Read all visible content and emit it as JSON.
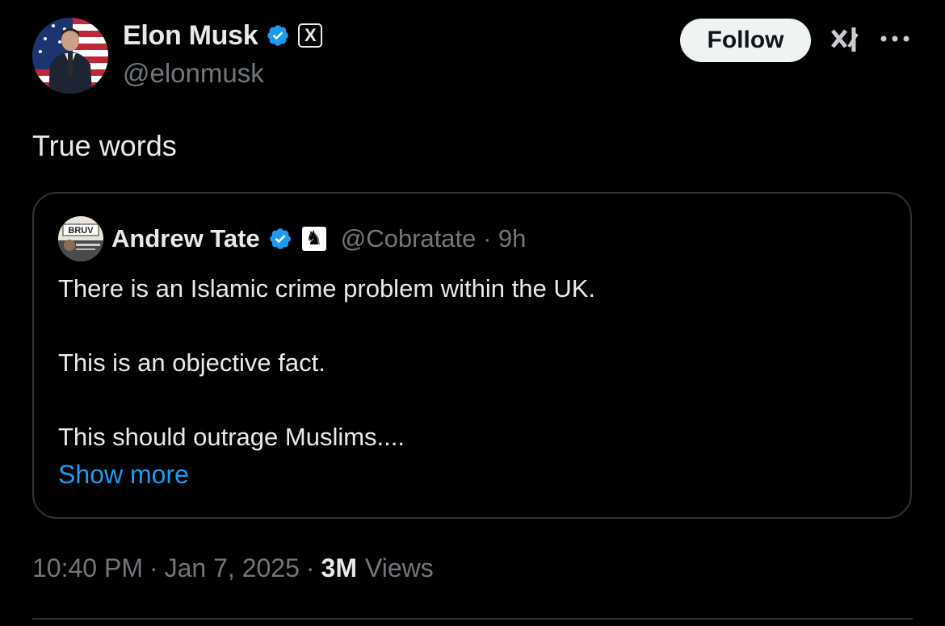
{
  "author": {
    "display_name": "Elon Musk",
    "handle": "@elonmusk",
    "verified_badge_color": "#1d9bf0",
    "affiliation_badge_glyph": "X"
  },
  "actions": {
    "follow_label": "Follow",
    "grok_icon": "grok-icon",
    "more_icon": "more-icon"
  },
  "tweet": {
    "text": "True words"
  },
  "quoted_tweet": {
    "display_name": "Andrew Tate",
    "handle": "@Cobratate",
    "separator": "·",
    "time_ago": "9h",
    "affiliation_badge_glyph": "♞",
    "lines": [
      "There is an Islamic crime problem within the UK.",
      "This is an objective fact.",
      "This should outrage Muslims...."
    ],
    "show_more_label": "Show more",
    "avatar_text": "BRUV"
  },
  "meta": {
    "time": "10:40 PM",
    "date": "Jan 7, 2025",
    "separator": "·",
    "views_count": "3M",
    "views_label": "Views"
  },
  "colors": {
    "background": "#000000",
    "text_primary": "#e7e9ea",
    "text_secondary": "#71767b",
    "accent": "#1d9bf0",
    "border": "#2f3336"
  }
}
